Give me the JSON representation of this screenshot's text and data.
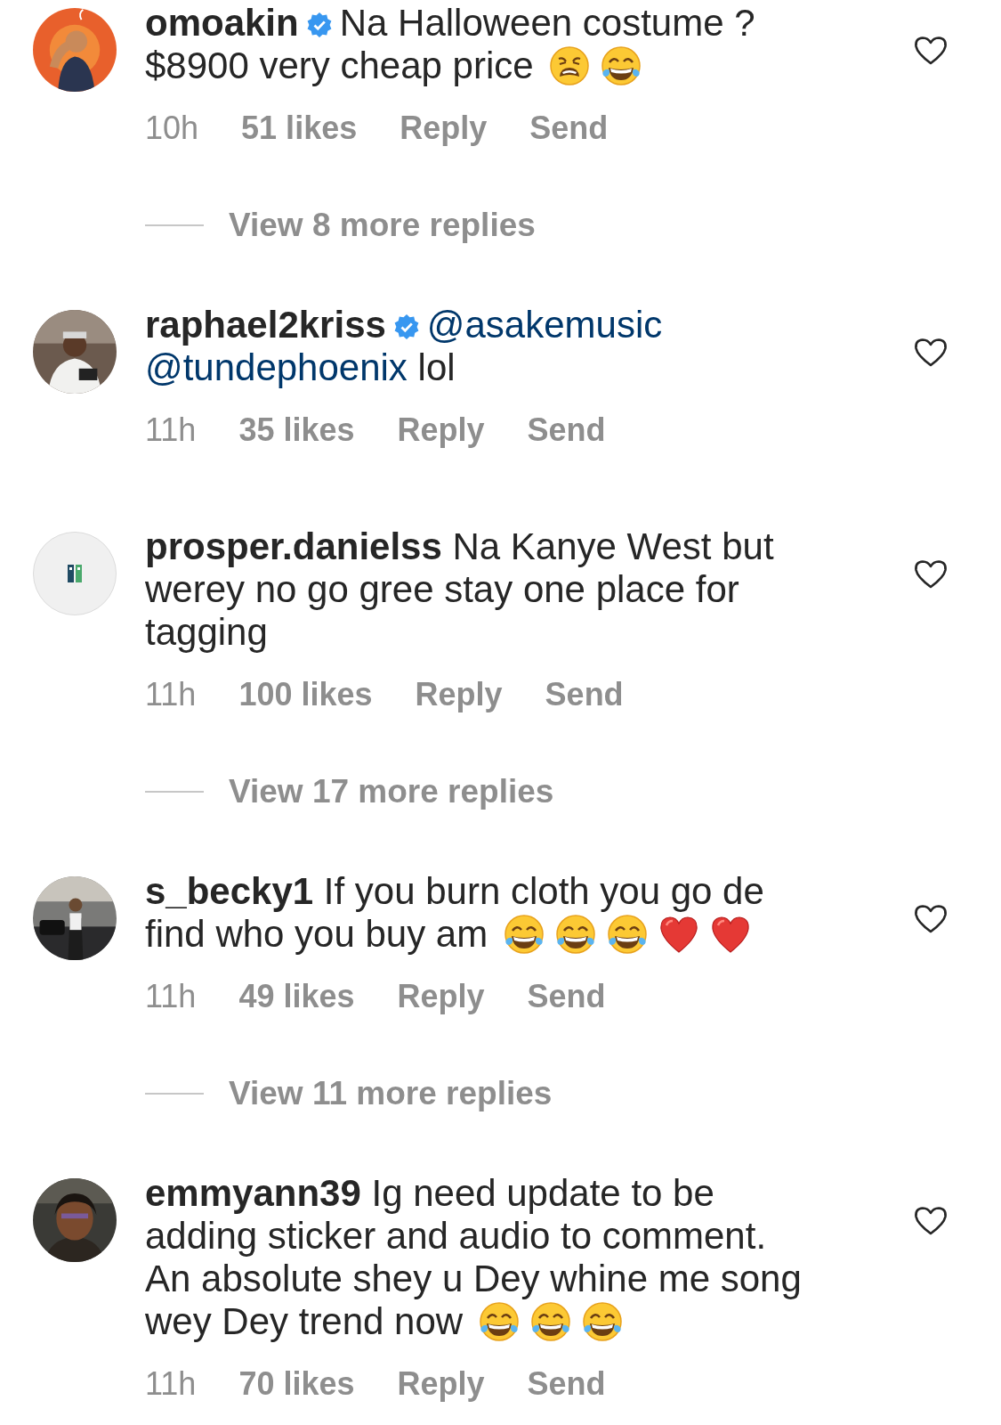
{
  "comments": [
    {
      "username": "omoakin",
      "verified": true,
      "avatar": {
        "kind": "picture"
      },
      "lines": [
        [
          {
            "kind": "text",
            "text": "Na Halloween costume ?"
          }
        ],
        [
          {
            "kind": "text",
            "text": "$8900 very cheap price "
          },
          {
            "kind": "tired-face"
          },
          {
            "kind": "joy-face"
          }
        ]
      ],
      "time": "10h",
      "likes": "51 likes",
      "reply": "Reply",
      "send": "Send",
      "more_replies": "View 8 more replies"
    },
    {
      "username": "raphael2kriss",
      "verified": true,
      "avatar": {
        "kind": "picture"
      },
      "lines": [
        [
          {
            "kind": "mention",
            "text": "@asakemusic"
          }
        ],
        [
          {
            "kind": "mention",
            "text": "@tundephoenix"
          },
          {
            "kind": "text",
            "text": " lol"
          }
        ]
      ],
      "time": "11h",
      "likes": "35 likes",
      "reply": "Reply",
      "send": "Send"
    },
    {
      "username": "prosper.danielss",
      "verified": false,
      "avatar": {
        "kind": "logo"
      },
      "lines": [
        [
          {
            "kind": "text",
            "text": "Na Kanye West but"
          }
        ],
        [
          {
            "kind": "text",
            "text": "werey no go gree stay one place for"
          }
        ],
        [
          {
            "kind": "text",
            "text": "tagging"
          }
        ]
      ],
      "time": "11h",
      "likes": "100 likes",
      "reply": "Reply",
      "send": "Send",
      "more_replies": "View 17 more replies"
    },
    {
      "username": "s_becky1",
      "verified": false,
      "avatar": {
        "kind": "picture"
      },
      "lines": [
        [
          {
            "kind": "text",
            "text": "If you burn cloth you go de"
          }
        ],
        [
          {
            "kind": "text",
            "text": "find who you buy am "
          },
          {
            "kind": "joy-face"
          },
          {
            "kind": "joy-face"
          },
          {
            "kind": "joy-face"
          },
          {
            "kind": "red-heart"
          },
          {
            "kind": "red-heart"
          }
        ]
      ],
      "time": "11h",
      "likes": "49 likes",
      "reply": "Reply",
      "send": "Send",
      "more_replies": "View 11 more replies"
    },
    {
      "username": "emmyann39",
      "verified": false,
      "avatar": {
        "kind": "picture"
      },
      "lines": [
        [
          {
            "kind": "text",
            "text": "Ig need update to be"
          }
        ],
        [
          {
            "kind": "text",
            "text": "adding sticker and audio to comment."
          }
        ],
        [
          {
            "kind": "text",
            "text": "An absolute shey u Dey whine me song"
          }
        ],
        [
          {
            "kind": "text",
            "text": "wey Dey trend now "
          },
          {
            "kind": "joy-face"
          },
          {
            "kind": "joy-face"
          },
          {
            "kind": "joy-face"
          }
        ]
      ],
      "time": "11h",
      "likes": "70 likes",
      "reply": "Reply",
      "send": "Send"
    }
  ]
}
